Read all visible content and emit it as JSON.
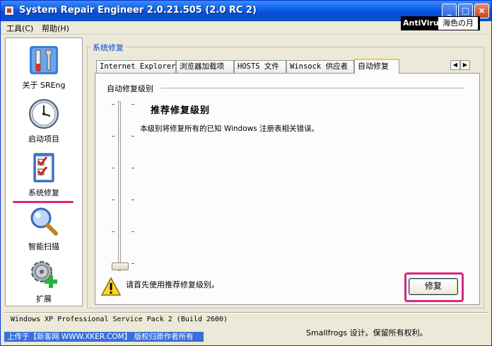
{
  "window": {
    "title": "System Repair Engineer 2.0.21.505 (2.0 RC 2)",
    "controls": [
      "minimize",
      "maximize",
      "close"
    ]
  },
  "overlay": {
    "antivirus": "AntiVirus",
    "tag": "海色の月"
  },
  "menu": {
    "items": [
      "工具(C)",
      "帮助(H)"
    ]
  },
  "sidebar": {
    "items": [
      {
        "label": "关于 SREng",
        "icon": "wrench-screwdriver-icon"
      },
      {
        "label": "启动项目",
        "icon": "clock-icon"
      },
      {
        "label": "系统修复",
        "icon": "checklist-icon",
        "selected": true
      },
      {
        "label": "智能扫描",
        "icon": "magnifier-icon"
      },
      {
        "label": "扩展",
        "icon": "gear-plus-icon"
      }
    ]
  },
  "panel": {
    "caption": "系统修复",
    "tabs": [
      {
        "label": "Internet Explorer"
      },
      {
        "label": "浏览器加载项"
      },
      {
        "label": "HOSTS 文件"
      },
      {
        "label": "Winsock 供应者"
      },
      {
        "label": "自动修复",
        "active": true
      }
    ],
    "group_title": "自动修复级别",
    "slider_level": 0,
    "level_title": "推荐修复级别",
    "level_desc": "本级别将修复所有的已知 Windows 注册表相关错误。",
    "warning": "请首先使用推荐修复级别。",
    "fix_button": "修复"
  },
  "status": {
    "os": "Windows XP Professional Service Pack 2 (Build 2600)",
    "copyright": "Smallfrogs 设计。保留所有权利。",
    "upload_note": "上传于【新客网 WWW.XKER.COM】 版权归原作者所有"
  }
}
